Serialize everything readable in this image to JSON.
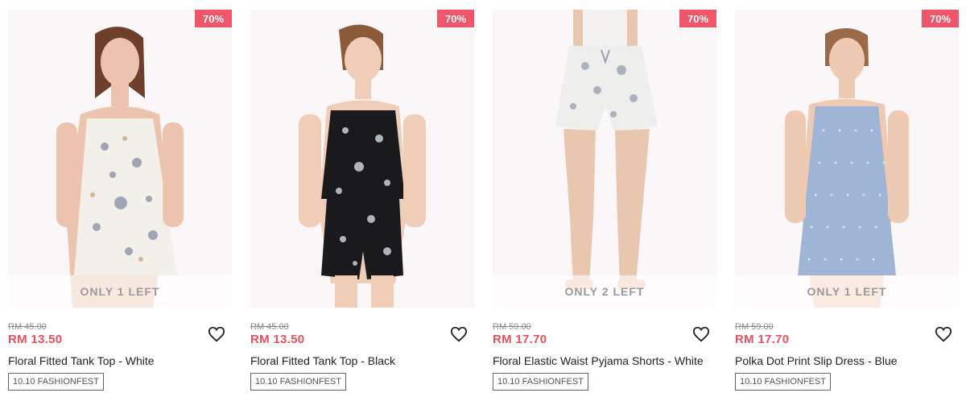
{
  "products": [
    {
      "discount": "70%",
      "stock": "ONLY 1 LEFT",
      "old_price": "RM 45.00",
      "price": "RM 13.50",
      "name": "Floral Fitted Tank Top - White",
      "tag": "10.10 FASHIONFEST",
      "image": "model-white-floral-tank-top"
    },
    {
      "discount": "70%",
      "stock": "",
      "old_price": "RM 45.00",
      "price": "RM 13.50",
      "name": "Floral Fitted Tank Top - Black",
      "tag": "10.10 FASHIONFEST",
      "image": "model-black-floral-tank-top"
    },
    {
      "discount": "70%",
      "stock": "ONLY 2 LEFT",
      "old_price": "RM 59.00",
      "price": "RM 17.70",
      "name": "Floral Elastic Waist Pyjama Shorts - White",
      "tag": "10.10 FASHIONFEST",
      "image": "model-white-floral-shorts"
    },
    {
      "discount": "70%",
      "stock": "ONLY 1 LEFT",
      "old_price": "RM 59.00",
      "price": "RM 17.70",
      "name": "Polka Dot Print Slip Dress - Blue",
      "tag": "10.10 FASHIONFEST",
      "image": "model-blue-polka-dot-dress"
    }
  ],
  "icons": {
    "wishlist": "heart-outline-icon"
  },
  "colors": {
    "badge": "#f0566a",
    "sale_price": "#e8505f",
    "image_bg": "#fbf7f8"
  }
}
